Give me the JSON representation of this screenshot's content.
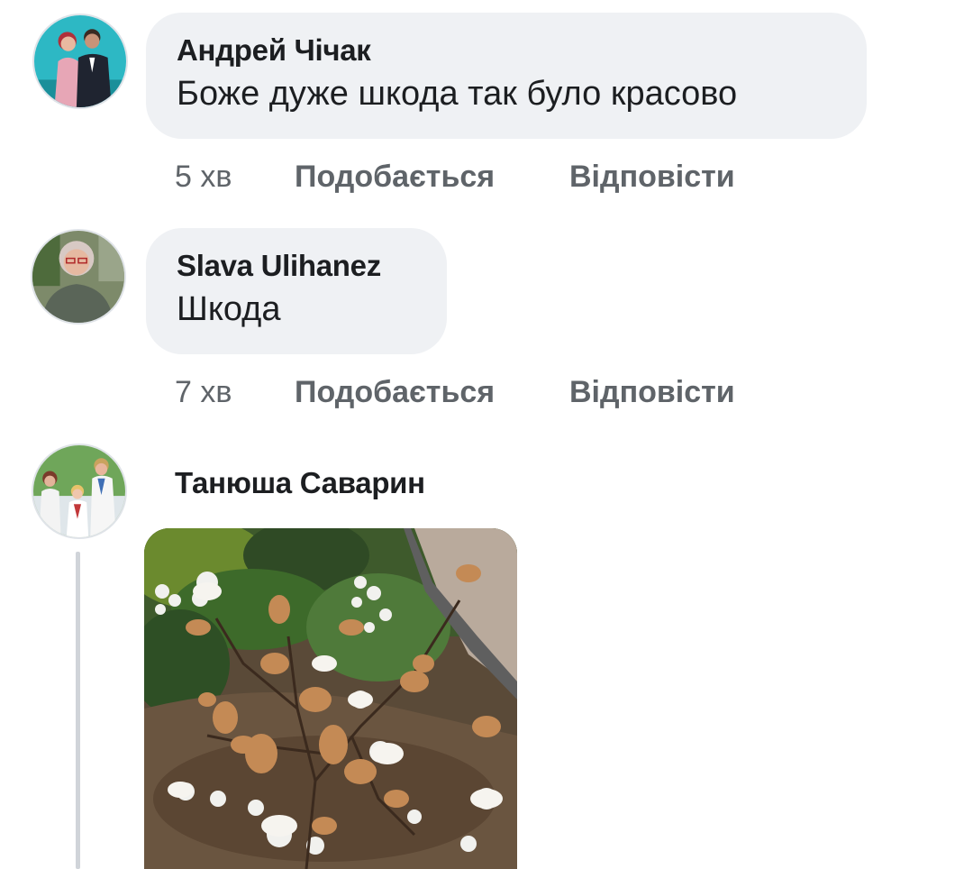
{
  "comments": [
    {
      "author": "Андрей Чічак",
      "text": "Боже дуже шкода так було красово",
      "time": "5 хв",
      "like_label": "Подобається",
      "reply_label": "Відповісти"
    },
    {
      "author": "Slava Ulihanez",
      "text": "Шкода",
      "time": "7 хв",
      "like_label": "Подобається",
      "reply_label": "Відповісти"
    },
    {
      "author": "Танюша Саварин",
      "attachment": "photo-of-wilted-magnolia-bush"
    }
  ],
  "colors": {
    "bubble": "#eff1f4",
    "text": "#1c1e21",
    "meta": "#5f6469",
    "thread_line": "#d0d4d9"
  }
}
